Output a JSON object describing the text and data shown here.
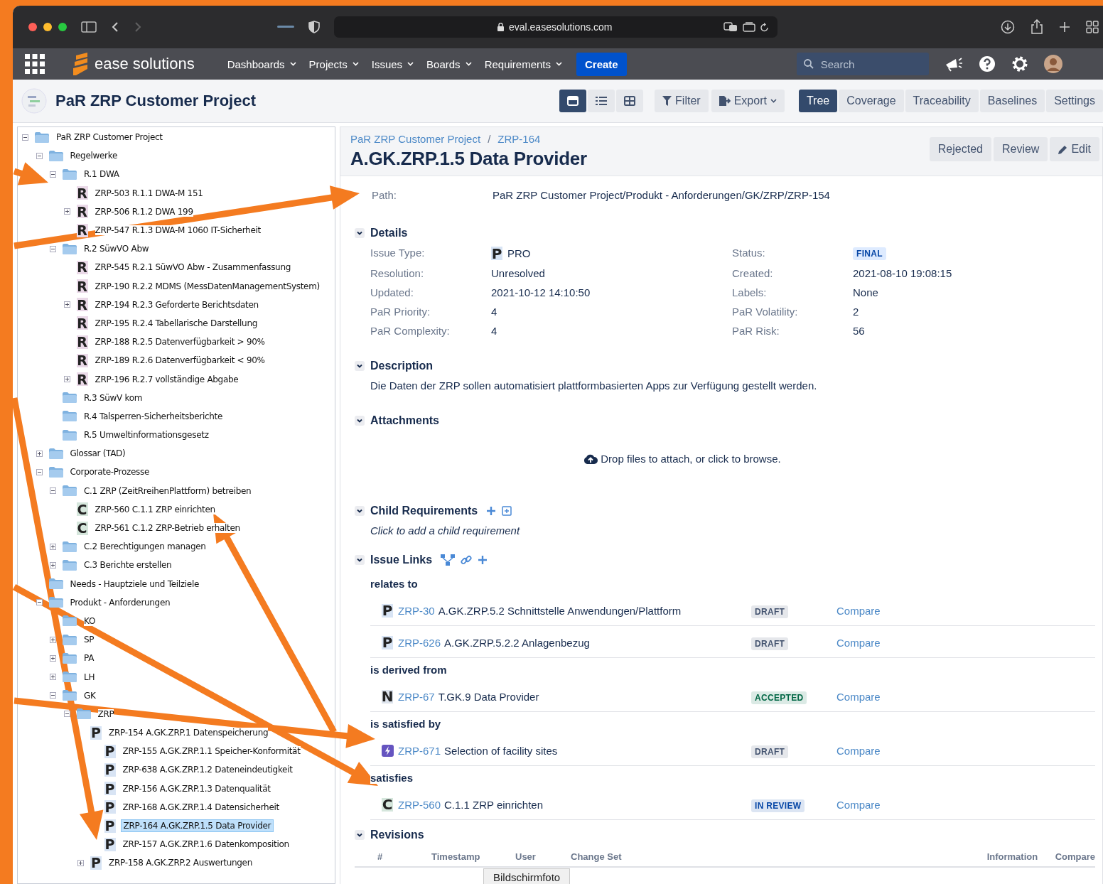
{
  "browser": {
    "url": "eval.easesolutions.com"
  },
  "app_nav": {
    "logo": "ease solutions",
    "menus": [
      "Dashboards",
      "Projects",
      "Issues",
      "Boards",
      "Requirements"
    ],
    "create": "Create",
    "search": {
      "placeholder": "Search"
    }
  },
  "project_bar": {
    "title": "PaR ZRP Customer Project",
    "views": [
      {
        "selected": true
      },
      {
        "selected": false
      },
      {
        "selected": false
      }
    ],
    "filter": "Filter",
    "export": "Export",
    "tabs": [
      {
        "label": "Tree",
        "selected": true
      },
      {
        "label": "Coverage",
        "selected": false
      },
      {
        "label": "Traceability",
        "selected": false
      },
      {
        "label": "Baselines",
        "selected": false
      },
      {
        "label": "Settings",
        "selected": false
      }
    ]
  },
  "tree": [
    {
      "label": "PaR ZRP Customer Project",
      "kind": "folder",
      "expanded": true,
      "selected": false,
      "children": [
        {
          "label": "Regelwerke",
          "kind": "folder",
          "expanded": true,
          "selected": false,
          "children": [
            {
              "label": "R.1 DWA",
              "kind": "folder",
              "expanded": true,
              "selected": false,
              "children": [
                {
                  "label": "ZRP-503 R.1.1 DWA-M 151",
                  "kind": "issue",
                  "icon": "R",
                  "color": "#ead9e8",
                  "selected": false
                },
                {
                  "label": "ZRP-506 R.1.2 DWA 199",
                  "kind": "issue",
                  "icon": "R",
                  "color": "#ead9e8",
                  "expanded": false,
                  "selected": false
                },
                {
                  "label": "ZRP-547 R.1.3 DWA-M 1060 IT-Sicherheit",
                  "kind": "issue",
                  "icon": "R",
                  "color": "#ead9e8",
                  "selected": false
                }
              ]
            },
            {
              "label": "R.2 SüwVO Abw",
              "kind": "folder",
              "expanded": true,
              "selected": false,
              "children": [
                {
                  "label": "ZRP-545 R.2.1 SüwVO Abw - Zusammenfassung",
                  "kind": "issue",
                  "icon": "R",
                  "color": "#ead9e8",
                  "selected": false
                },
                {
                  "label": "ZRP-190 R.2.2 MDMS (MessDatenManagementSystem)",
                  "kind": "issue",
                  "icon": "R",
                  "color": "#ead9e8",
                  "selected": false
                },
                {
                  "label": "ZRP-194 R.2.3 Geforderte Berichtsdaten",
                  "kind": "issue",
                  "icon": "R",
                  "color": "#ead9e8",
                  "expanded": false,
                  "selected": false
                },
                {
                  "label": "ZRP-195 R.2.4 Tabellarische Darstellung",
                  "kind": "issue",
                  "icon": "R",
                  "color": "#ead9e8",
                  "selected": false
                },
                {
                  "label": "ZRP-188 R.2.5 Datenverfügbarkeit > 90%",
                  "kind": "issue",
                  "icon": "R",
                  "color": "#ead9e8",
                  "selected": false
                },
                {
                  "label": "ZRP-189 R.2.6 Datenverfügbarkeit < 90%",
                  "kind": "issue",
                  "icon": "R",
                  "color": "#ead9e8",
                  "selected": false
                },
                {
                  "label": "ZRP-196 R.2.7 vollständige Abgabe",
                  "kind": "issue",
                  "icon": "R",
                  "color": "#ead9e8",
                  "expanded": false,
                  "selected": false
                }
              ]
            },
            {
              "label": "R.3 SüwV kom",
              "kind": "folder",
              "selected": false
            },
            {
              "label": "R.4 Talsperren-Sicherheitsberichte",
              "kind": "folder",
              "selected": false
            },
            {
              "label": "R.5 Umweltinformationsgesetz",
              "kind": "folder",
              "selected": false
            }
          ]
        },
        {
          "label": "Glossar (TAD)",
          "kind": "folder",
          "expanded": false,
          "selected": false
        },
        {
          "label": "Corporate-Prozesse",
          "kind": "folder",
          "expanded": true,
          "selected": false,
          "children": [
            {
              "label": "C.1 ZRP (ZeitRreihenPlattform) betreiben",
              "kind": "folder",
              "expanded": true,
              "selected": false,
              "children": [
                {
                  "label": "ZRP-560 C.1.1 ZRP einrichten",
                  "kind": "issue",
                  "icon": "C",
                  "color": "#d5e6dc",
                  "selected": false
                },
                {
                  "label": "ZRP-561 C.1.2 ZRP-Betrieb erhalten",
                  "kind": "issue",
                  "icon": "C",
                  "color": "#d5e6dc",
                  "selected": false
                }
              ]
            },
            {
              "label": "C.2 Berechtigungen managen",
              "kind": "folder",
              "expanded": false,
              "selected": false
            },
            {
              "label": "C.3 Berichte erstellen",
              "kind": "folder",
              "expanded": false,
              "selected": false
            }
          ]
        },
        {
          "label": "Needs - Hauptziele und Teilziele",
          "kind": "folder",
          "selected": false
        },
        {
          "label": "Produkt - Anforderungen",
          "kind": "folder",
          "expanded": true,
          "selected": false,
          "children": [
            {
              "label": "KO",
              "kind": "folder",
              "selected": false
            },
            {
              "label": "SP",
              "kind": "folder",
              "expanded": false,
              "selected": false
            },
            {
              "label": "PA",
              "kind": "folder",
              "expanded": false,
              "selected": false
            },
            {
              "label": "LH",
              "kind": "folder",
              "expanded": false,
              "selected": false
            },
            {
              "label": "GK",
              "kind": "folder",
              "expanded": true,
              "selected": false,
              "children": [
                {
                  "label": "ZRP",
                  "kind": "folder",
                  "expanded": true,
                  "selected": false,
                  "children": [
                    {
                      "label": "ZRP-154 A.GK.ZRP.1 Datenspeicherung",
                      "kind": "issue",
                      "icon": "P",
                      "color": "#d8e4f4",
                      "selected": false,
                      "children": [
                        {
                          "label": "ZRP-155 A.GK.ZRP.1.1 Speicher-Konformität",
                          "kind": "issue",
                          "icon": "P",
                          "color": "#d8e4f4",
                          "selected": false
                        },
                        {
                          "label": "ZRP-638 A.GK.ZRP.1.2 Dateneindeutigkeit",
                          "kind": "issue",
                          "icon": "P",
                          "color": "#d8e4f4",
                          "selected": false
                        },
                        {
                          "label": "ZRP-156 A.GK.ZRP.1.3 Datenqualität",
                          "kind": "issue",
                          "icon": "P",
                          "color": "#d8e4f4",
                          "selected": false
                        },
                        {
                          "label": "ZRP-168 A.GK.ZRP.1.4 Datensicherheit",
                          "kind": "issue",
                          "icon": "P",
                          "color": "#d8e4f4",
                          "selected": false
                        },
                        {
                          "label": "ZRP-164 A.GK.ZRP.1.5 Data Provider",
                          "kind": "issue",
                          "icon": "P",
                          "color": "#d8e4f4",
                          "selected": true
                        },
                        {
                          "label": "ZRP-157 A.GK.ZRP.1.6 Datenkomposition",
                          "kind": "issue",
                          "icon": "P",
                          "color": "#d8e4f4",
                          "selected": false
                        }
                      ]
                    },
                    {
                      "label": "ZRP-158 A.GK.ZRP.2 Auswertungen",
                      "kind": "issue",
                      "icon": "P",
                      "color": "#d8e4f4",
                      "expanded": false,
                      "selected": false
                    }
                  ]
                }
              ]
            }
          ]
        }
      ]
    }
  ],
  "issue": {
    "breadcrumb": [
      "PaR ZRP Customer Project",
      "ZRP-164"
    ],
    "separator": "/",
    "title": "A.GK.ZRP.1.5 Data Provider",
    "actions": [
      "Rejected",
      "Review",
      "Edit"
    ],
    "path": {
      "label": "Path:",
      "value": "PaR ZRP Customer Project/Produkt - Anforderungen/GK/ZRP/ZRP-154"
    },
    "details": {
      "title": "Details",
      "fields": [
        {
          "label": "Issue Type:",
          "value": "PRO",
          "icon": "P",
          "kind": "type"
        },
        {
          "label": "Status:",
          "value": "FINAL",
          "kind": "status"
        },
        {
          "label": "Resolution:",
          "value": "Unresolved",
          "kind": "text"
        },
        {
          "label": "Created:",
          "value": "2021-08-10 19:08:15",
          "kind": "text"
        },
        {
          "label": "Updated:",
          "value": "2021-10-12 14:10:50",
          "kind": "text"
        },
        {
          "label": "Labels:",
          "value": "None",
          "kind": "text"
        },
        {
          "label": "PaR Priority:",
          "value": "4",
          "kind": "text"
        },
        {
          "label": "PaR Volatility:",
          "value": "2",
          "kind": "text"
        },
        {
          "label": "PaR Complexity:",
          "value": "4",
          "kind": "text"
        },
        {
          "label": "PaR Risk:",
          "value": "56",
          "kind": "text"
        }
      ]
    },
    "description": {
      "title": "Description",
      "text": "Die Daten der ZRP sollen automatisiert plattformbasierten Apps zur Verfügung gestellt werden."
    },
    "attachments": {
      "title": "Attachments",
      "drop": "Drop files to attach, or click to browse."
    },
    "children": {
      "title": "Child Requirements",
      "hint": "Click to add a child requirement"
    },
    "links": {
      "title": "Issue Links",
      "groups": [
        {
          "relation": "relates to",
          "items": [
            {
              "icon": "P",
              "kind": "letter",
              "color": "#d8e4f4",
              "key": "ZRP-30",
              "summary": "A.GK.ZRP.5.2 Schnittstelle Anwendungen/Plattform",
              "status": {
                "text": "DRAFT",
                "color": "#42526e"
              },
              "compare": "Compare"
            },
            {
              "icon": "P",
              "kind": "letter",
              "color": "#d8e4f4",
              "key": "ZRP-626",
              "summary": "A.GK.ZRP.5.2.2 Anlagenbezug",
              "status": {
                "text": "DRAFT",
                "color": "#42526e"
              },
              "compare": "Compare"
            }
          ]
        },
        {
          "relation": "is derived from",
          "items": [
            {
              "icon": "N",
              "kind": "letter",
              "color": "#dde3ec",
              "key": "ZRP-67",
              "summary": "T.GK.9 Data Provider",
              "status": {
                "text": "ACCEPTED",
                "color": "#006644"
              },
              "compare": "Compare"
            }
          ]
        },
        {
          "relation": "is satisfied by",
          "items": [
            {
              "kind": "bolt",
              "color": "#6554c0",
              "key": "ZRP-671",
              "summary": "Selection of facility sites",
              "status": {
                "text": "DRAFT",
                "color": "#42526e"
              },
              "compare": "Compare"
            }
          ]
        },
        {
          "relation": "satisfies",
          "items": [
            {
              "icon": "C",
              "kind": "letter",
              "color": "#d5e6dc",
              "key": "ZRP-560",
              "summary": "C.1.1 ZRP einrichten",
              "status": {
                "text": "IN REVIEW",
                "color": "#0747a6"
              },
              "compare": "Compare"
            }
          ]
        }
      ]
    },
    "revisions": {
      "title": "Revisions",
      "columns": [
        "#",
        "Timestamp",
        "User",
        "Change Set",
        "Information",
        "Compare"
      ]
    }
  },
  "tooltip": "Bildschirmfoto"
}
